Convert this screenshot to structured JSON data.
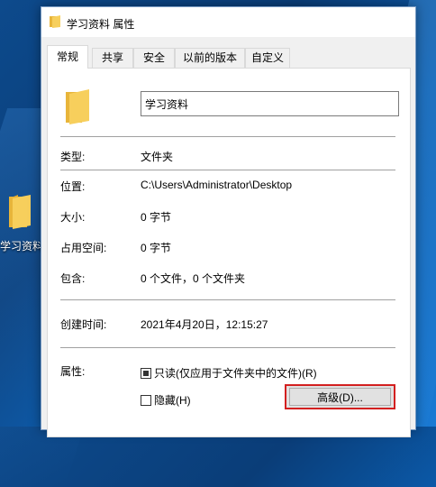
{
  "desktop": {
    "icon_label": "学习资料"
  },
  "window": {
    "title": "学习资料 属性",
    "tabs": [
      "常规",
      "共享",
      "安全",
      "以前的版本",
      "自定义"
    ],
    "active_tab": "常规",
    "name_value": "学习资料",
    "rows": {
      "type": {
        "label": "类型:",
        "value": "文件夹"
      },
      "location": {
        "label": "位置:",
        "value": "C:\\Users\\Administrator\\Desktop"
      },
      "size": {
        "label": "大小:",
        "value": "0 字节"
      },
      "size_on_disk": {
        "label": "占用空间:",
        "value": "0 字节"
      },
      "contains": {
        "label": "包含:",
        "value": "0 个文件，0 个文件夹"
      },
      "created": {
        "label": "创建时间:",
        "value": "2021年4月20日，12:15:27"
      },
      "attributes": {
        "label": "属性:"
      }
    },
    "readonly_label": "只读(仅应用于文件夹中的文件)(R)",
    "readonly_checked": true,
    "hidden_label": "隐藏(H)",
    "hidden_checked": false,
    "advanced_button": "高级(D)...",
    "highlight_color": "#d32020",
    "folder_color": "#f5c84c"
  }
}
